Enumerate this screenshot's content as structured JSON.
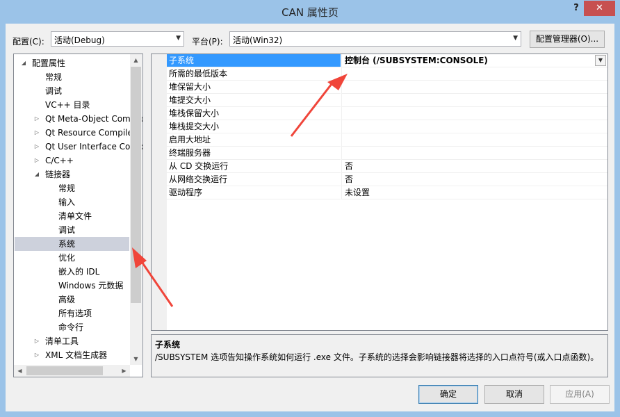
{
  "window": {
    "title": "CAN 属性页",
    "help_glyph": "?",
    "close_glyph": "✕"
  },
  "toolbar": {
    "config_label": "配置(C):",
    "config_value": "活动(Debug)",
    "platform_label": "平台(P):",
    "platform_value": "活动(Win32)",
    "config_manager_label": "配置管理器(O)..."
  },
  "tree": {
    "items": [
      {
        "label": "配置属性",
        "expander": "◢"
      },
      {
        "label": "常规"
      },
      {
        "label": "调试"
      },
      {
        "label": "VC++ 目录"
      },
      {
        "label": "Qt Meta-Object Compiler",
        "expander": "▷"
      },
      {
        "label": "Qt Resource Compiler",
        "expander": "▷"
      },
      {
        "label": "Qt User Interface Compiler",
        "expander": "▷"
      },
      {
        "label": "C/C++",
        "expander": "▷"
      },
      {
        "label": "链接器",
        "expander": "◢"
      },
      {
        "label": "常规"
      },
      {
        "label": "输入"
      },
      {
        "label": "清单文件"
      },
      {
        "label": "调试"
      },
      {
        "label": "系统",
        "selected": true
      },
      {
        "label": "优化"
      },
      {
        "label": "嵌入的 IDL"
      },
      {
        "label": "Windows 元数据"
      },
      {
        "label": "高级"
      },
      {
        "label": "所有选项"
      },
      {
        "label": "命令行"
      },
      {
        "label": "清单工具",
        "expander": "▷"
      },
      {
        "label": "XML 文档生成器",
        "expander": "▷"
      }
    ]
  },
  "properties": {
    "rows": [
      {
        "name": "子系统",
        "value": "控制台 (/SUBSYSTEM:CONSOLE)",
        "selected": true
      },
      {
        "name": "所需的最低版本",
        "value": ""
      },
      {
        "name": "堆保留大小",
        "value": ""
      },
      {
        "name": "堆提交大小",
        "value": ""
      },
      {
        "name": "堆栈保留大小",
        "value": ""
      },
      {
        "name": "堆栈提交大小",
        "value": ""
      },
      {
        "name": "启用大地址",
        "value": ""
      },
      {
        "name": "终端服务器",
        "value": ""
      },
      {
        "name": "从 CD 交换运行",
        "value": "否"
      },
      {
        "name": "从网络交换运行",
        "value": "否"
      },
      {
        "name": "驱动程序",
        "value": "未设置"
      }
    ]
  },
  "description": {
    "title": "子系统",
    "text": "/SUBSYSTEM 选项告知操作系统如何运行 .exe 文件。子系统的选择会影响链接器将选择的入口点符号(或入口点函数)。"
  },
  "buttons": {
    "ok": "确定",
    "cancel": "取消",
    "apply": "应用(A)"
  },
  "colors": {
    "arrow": "#f0453a",
    "selection": "#3399ff"
  }
}
